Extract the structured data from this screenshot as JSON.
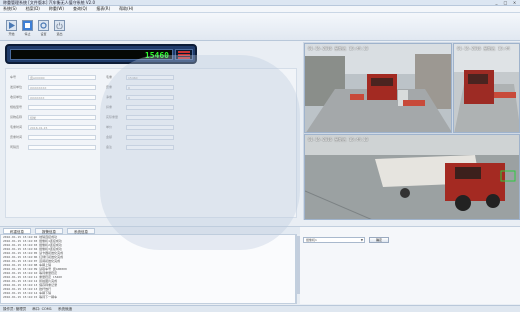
{
  "window": {
    "title": "称重管理系统 [文件版本] 汽车衡无人值守系统 V2.0"
  },
  "menu": [
    "系统(S)",
    "档案(D)",
    "称重(W)",
    "查询(Q)",
    "报表(R)",
    "帮助(H)"
  ],
  "toolbar": {
    "buttons": [
      {
        "label": "开始",
        "icon": "play-icon"
      },
      {
        "label": "停止",
        "icon": "stop-icon"
      },
      {
        "label": "设置",
        "icon": "settings-icon"
      },
      {
        "label": "退出",
        "icon": "power-icon"
      }
    ]
  },
  "weight": {
    "value": "15460"
  },
  "form": {
    "left": [
      {
        "label": "车号",
        "value": "冀A00000"
      },
      {
        "label": "发货单位",
        "value": "XXXXXXXX"
      },
      {
        "label": "收货单位",
        "value": "XXXXXXX"
      },
      {
        "label": "规格型号",
        "value": ""
      },
      {
        "label": "货物名称",
        "value": "煤炭"
      },
      {
        "label": "毛重时间",
        "value": "2016-01-15"
      },
      {
        "label": "皮重时间",
        "value": ""
      },
      {
        "label": "司磅员",
        "value": ""
      }
    ],
    "right": [
      {
        "label": "毛重",
        "value": "15460"
      },
      {
        "label": "皮重",
        "value": "0"
      },
      {
        "label": "净重",
        "value": "0"
      },
      {
        "label": "扣重",
        "value": ""
      },
      {
        "label": "实际重量",
        "value": ""
      },
      {
        "label": "单价",
        "value": ""
      },
      {
        "label": "金额",
        "value": ""
      },
      {
        "label": "备注",
        "value": ""
      }
    ]
  },
  "cameras": [
    {
      "timestamp": "01-15-2016 星期五 15:44:13"
    },
    {
      "timestamp": "01-15-2016 星期五 15:44"
    },
    {
      "timestamp": "01-15-2016 星期五 15:44:13"
    }
  ],
  "logtabs": [
    "称重信息",
    "报警信息",
    "系统信息"
  ],
  "log": [
    "2016-01-15 15:44:02  地磅连接成功",
    "2016-01-15 15:44:03  摄像机1连接成功",
    "2016-01-15 15:44:03  摄像机2连接成功",
    "2016-01-15 15:44:04  摄像机3连接成功",
    "2016-01-15 15:44:05  读卡器初始化完成",
    "2016-01-15 15:44:06  红绿灯初始化完成",
    "2016-01-15 15:44:07  道闸初始化完成",
    "2016-01-15 15:44:08  车辆上磅",
    "2016-01-15 15:44:09  读取车号 冀A00000",
    "2016-01-15 15:44:10  等待重量稳定",
    "2016-01-15 15:44:11  重量稳定 15460",
    "2016-01-15 15:44:12  抓拍图片完成",
    "2016-01-15 15:44:13  保存称重记录",
    "2016-01-15 15:44:13  抬杆放行",
    "2016-01-15 15:44:14  车辆下磅",
    "2016-01-15 15:44:15  等待下一辆车"
  ],
  "right_panel": {
    "camera_select": "摄像机1",
    "confirm_label": "确定"
  },
  "status": [
    "操作员: 管理员",
    "串口: COM1",
    "系统就绪"
  ]
}
